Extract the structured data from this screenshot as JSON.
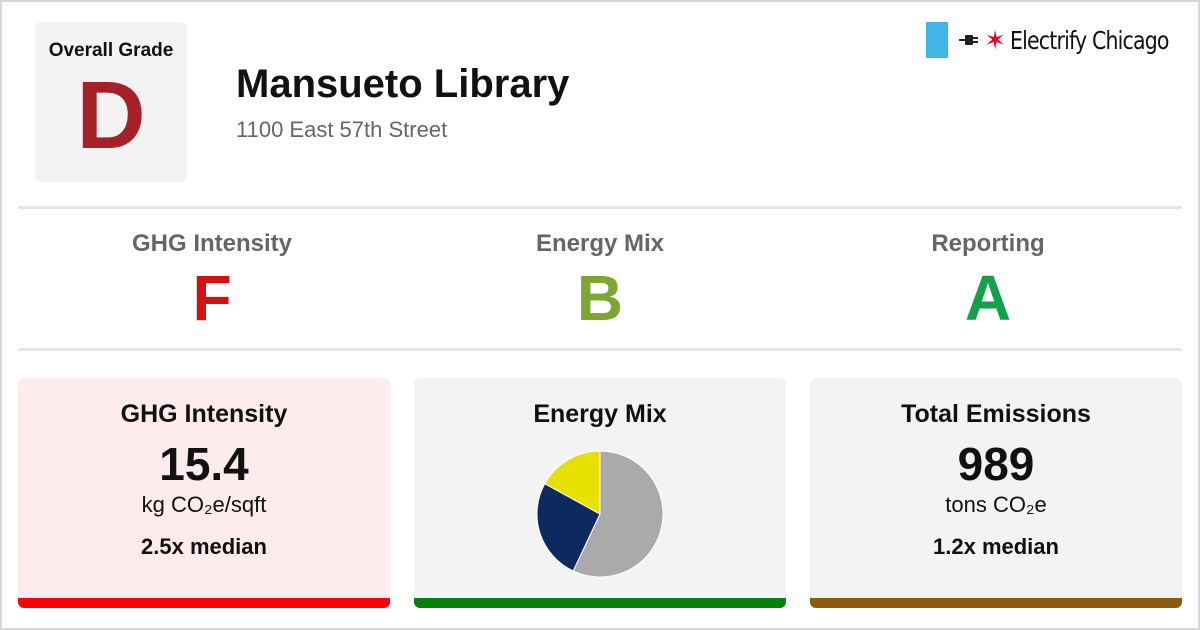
{
  "overall": {
    "label": "Overall Grade",
    "grade": "D",
    "color": "#a32127"
  },
  "building": {
    "name": "Mansueto Library",
    "address": "1100 East 57th Street"
  },
  "brand": {
    "name": "Electrify Chicago",
    "icons": [
      "chicago-flag-stripe",
      "plug-icon",
      "star-icon"
    ],
    "star": "✶"
  },
  "summary": [
    {
      "label": "GHG Intensity",
      "grade": "F",
      "color": "#d11212"
    },
    {
      "label": "Energy Mix",
      "grade": "B",
      "color": "#7ea632"
    },
    {
      "label": "Reporting",
      "grade": "A",
      "color": "#12a14a"
    }
  ],
  "cards": {
    "ghg": {
      "title": "GHG Intensity",
      "value": "15.4",
      "unit": "kg CO₂e/sqft",
      "median": "2.5x median",
      "bg": "#fdebee",
      "bar": "#ff0000"
    },
    "mix": {
      "title": "Energy Mix",
      "bg": "#f3f3f3",
      "bar": "#0a7f0a"
    },
    "emissions": {
      "title": "Total Emissions",
      "value": "989",
      "unit": "tons CO₂e",
      "median": "1.2x median",
      "bg": "#f3f3f3",
      "bar": "#8b5a10"
    }
  },
  "chart_data": {
    "type": "pie",
    "slices": [
      {
        "value": 0.57,
        "color": "#aaaaaa"
      },
      {
        "value": 0.26,
        "color": "#0d2a5e"
      },
      {
        "value": 0.17,
        "color": "#e8e000"
      }
    ]
  }
}
